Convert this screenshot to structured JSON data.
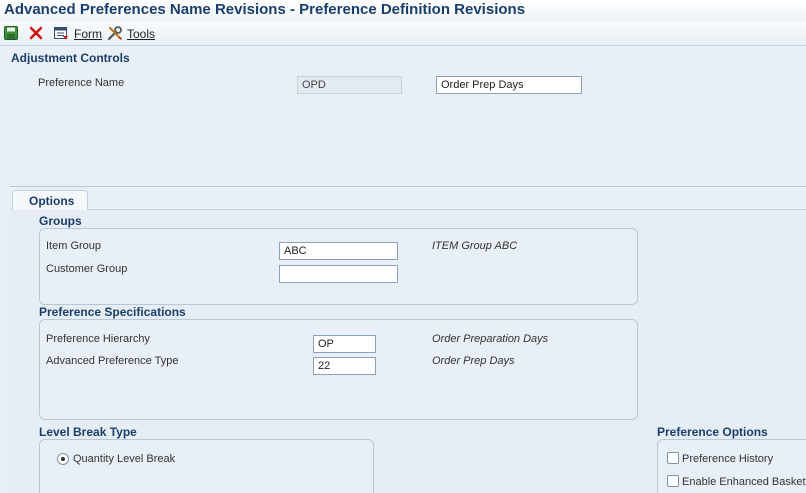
{
  "window": {
    "title": "Advanced Preferences Name Revisions - Preference Definition Revisions"
  },
  "toolbar": {
    "save_icon": "save-icon",
    "cancel_icon": "close-icon",
    "form_icon": "form-icon",
    "form_label": "Form",
    "tools_icon": "tools-icon",
    "tools_label": "Tools"
  },
  "adjustment_controls": {
    "heading": "Adjustment Controls",
    "preference_name_label": "Preference Name",
    "preference_name_code": "OPD",
    "preference_name_desc": "Order Prep Days"
  },
  "tabs": [
    {
      "label": "Options",
      "selected": true
    }
  ],
  "groups": {
    "heading": "Groups",
    "item_group_label": "Item Group",
    "item_group_value": "ABC",
    "item_group_desc": "ITEM Group ABC",
    "customer_group_label": "Customer Group",
    "customer_group_value": ""
  },
  "preference_specifications": {
    "heading": "Preference Specifications",
    "hierarchy_label": "Preference Hierarchy",
    "hierarchy_value": "OP",
    "hierarchy_desc": "Order Preparation Days",
    "type_label": "Advanced Preference Type",
    "type_value": "22",
    "type_desc": "Order Prep Days"
  },
  "level_break_type": {
    "heading": "Level Break Type",
    "option_label": "Quantity Level Break",
    "selected": true
  },
  "preference_options": {
    "heading": "Preference Options",
    "history_label": "Preference History",
    "history_checked": false,
    "enhanced_basket_label": "Enable Enhanced Basket",
    "enhanced_basket_checked": false
  },
  "colors": {
    "title": "#1a3e6b",
    "background": "#e9eff6",
    "cancel": "#cc1111"
  }
}
